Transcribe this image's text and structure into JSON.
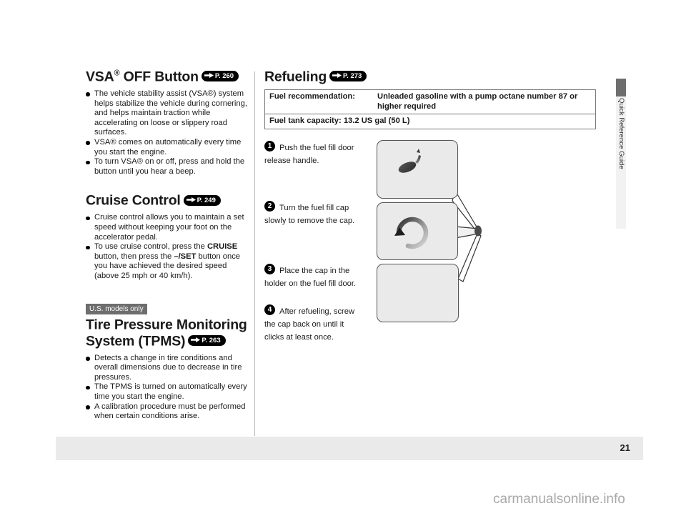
{
  "page": {
    "number": "21",
    "watermark": "carmanualsonline.info",
    "side_tab_label": "Quick Reference Guide"
  },
  "left_column": {
    "sections": [
      {
        "id": "vsa-off-button",
        "title_main": "VSA",
        "title_sup": "®",
        "title_rest": " OFF Button",
        "ref": {
          "arrow": "right-arrow-icon",
          "page": "P. 260"
        },
        "bullets": [
          "The vehicle stability assist (VSA®) system helps stabilize the vehicle during cornering, and helps maintain traction while accelerating on loose or slippery road surfaces.",
          "VSA® comes on automatically every time you start the engine.",
          "To turn VSA® on or off, press and hold the button until you hear a beep."
        ]
      },
      {
        "id": "cruise-control",
        "title_main": "Cruise Control",
        "title_sup": "",
        "title_rest": "",
        "ref": {
          "arrow": "right-arrow-icon",
          "page": "P. 249"
        },
        "bullets": [
          "Cruise control allows you to maintain a set speed without keeping your foot on the accelerator pedal.",
          "To use cruise control, press the CRUISE button, then press the –/SET button once you have achieved the desired speed (above 25 mph or 40 km/h)."
        ]
      },
      {
        "id": "tpms",
        "badge": "U.S. models only",
        "title_main": "Tire Pressure Monitoring System (TPMS)",
        "title_sup": "",
        "title_rest": "",
        "ref": {
          "arrow": "right-arrow-icon",
          "page": "P. 263"
        },
        "bullets": [
          "Detects a change in tire conditions and overall dimensions due to decrease in tire pressures.",
          "The TPMS is turned on automatically every time you start the engine.",
          "A calibration procedure must be performed when certain conditions arise."
        ]
      }
    ]
  },
  "right_column": {
    "section": {
      "id": "refueling",
      "title_main": "Refueling",
      "ref": {
        "arrow": "right-arrow-icon",
        "page": "P. 273"
      }
    },
    "fuel_table": {
      "rows": [
        {
          "label": "Fuel recommendation:",
          "value": "Unleaded gasoline with a pump octane number 87 or higher required"
        },
        {
          "label": "Fuel tank capacity: 13.2 US gal (50 L)",
          "value": ""
        }
      ]
    },
    "steps": [
      {
        "num": "1",
        "text": "Push the fuel fill door release handle."
      },
      {
        "num": "2",
        "text": "Turn the fuel fill cap slowly to remove the cap."
      },
      {
        "num": "3",
        "text": "Place the cap in the holder on the fuel fill door."
      },
      {
        "num": "4",
        "text": "After refueling, screw the cap back on until it clicks at least once."
      }
    ],
    "illustrations": [
      {
        "id": "panel-fuel-door-release",
        "caption": ""
      },
      {
        "id": "panel-fuel-cap-turn",
        "caption": ""
      },
      {
        "id": "panel-cap-holder",
        "caption": ""
      }
    ]
  },
  "colors": {
    "panel_fill": "#eaeaea",
    "panel_stroke": "#555555",
    "badge_gray": "#6e6e6e",
    "footer_band": "#eaeaea",
    "divider": "#b9b9b9",
    "watermark": "#a8a8a8"
  }
}
